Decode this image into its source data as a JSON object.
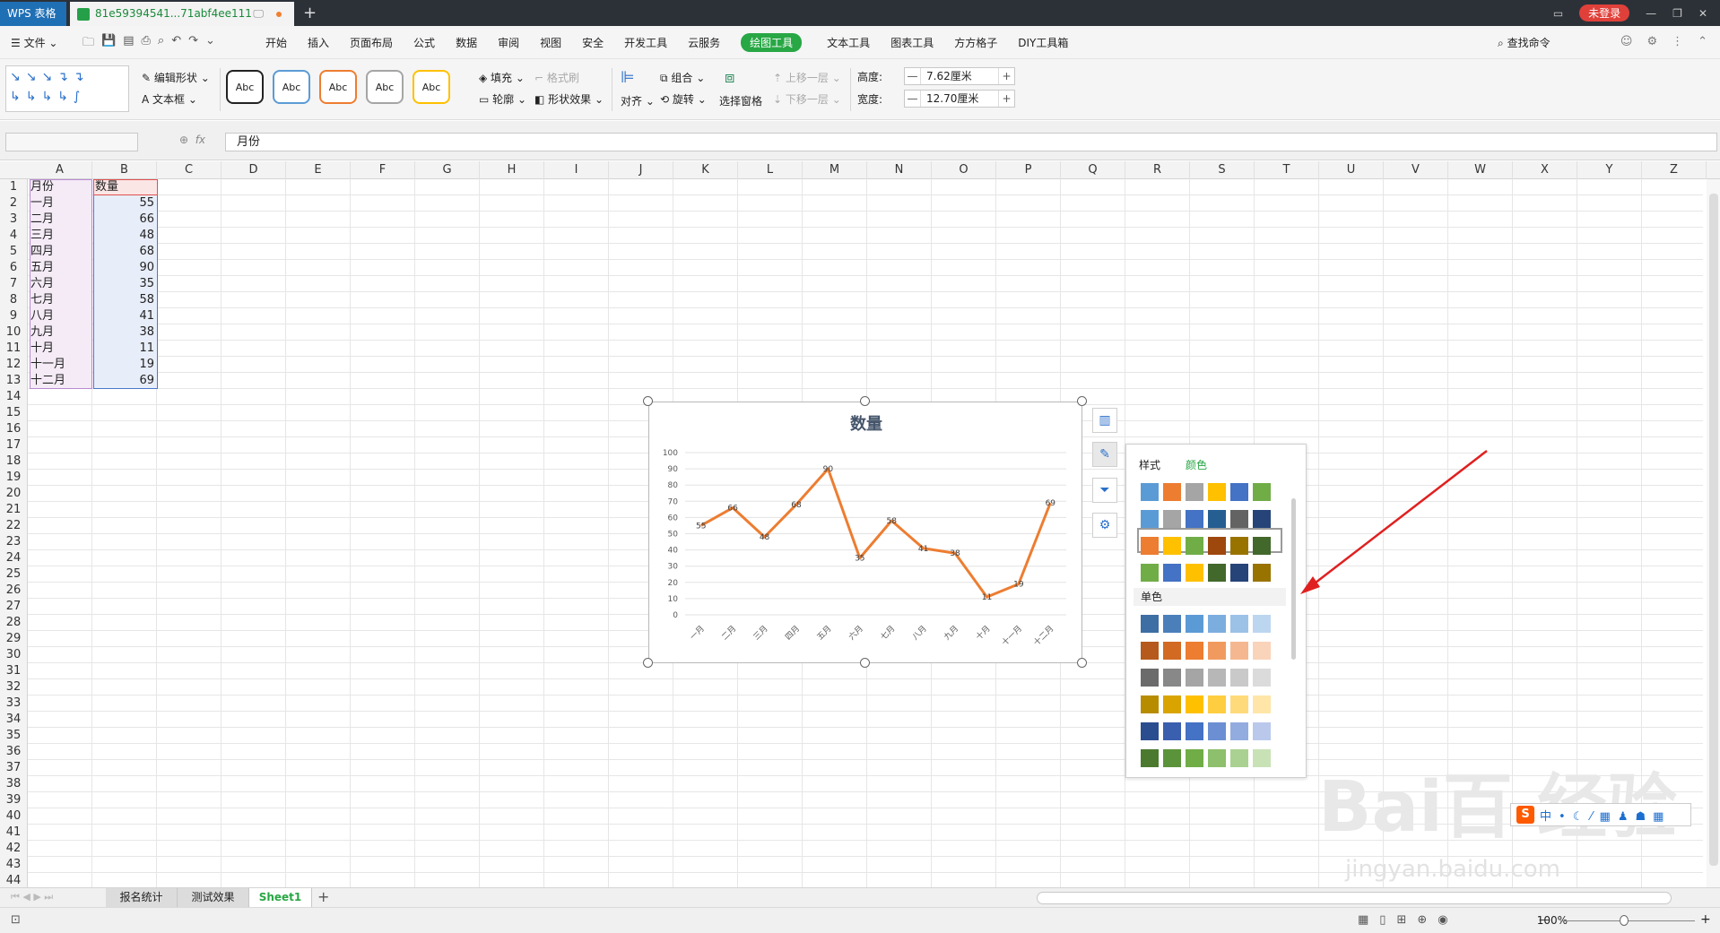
{
  "titlebar": {
    "app_tab": "WPS 表格",
    "doc_tab": "81e59394541...71abf4ee111",
    "new_tab": "+",
    "login": "未登录",
    "pin": "🖵",
    "min": "—",
    "max": "❐",
    "close": "✕"
  },
  "menubar": {
    "file": "文件",
    "items": [
      "开始",
      "插入",
      "页面布局",
      "公式",
      "数据",
      "审阅",
      "视图",
      "安全",
      "开发工具",
      "云服务",
      "绘图工具",
      "文本工具",
      "图表工具",
      "方方格子",
      "DIY工具箱"
    ],
    "active": "绘图工具",
    "search": "查找命令"
  },
  "toolbar": {
    "edit_shape": "编辑形状",
    "text_box": "文本框",
    "style_label": "Abc",
    "fill": "填充",
    "format_brush": "格式刷",
    "outline": "轮廓",
    "shape_effect": "形状效果",
    "align": "对齐",
    "group": "组合",
    "rotate": "旋转",
    "select_pane": "选择窗格",
    "bring_forward": "上移一层",
    "send_backward": "下移一层",
    "height_label": "高度:",
    "height_value": "7.62厘米",
    "width_label": "宽度:",
    "width_value": "12.70厘米",
    "minus": "—",
    "plus": "+"
  },
  "formula": {
    "fx": "fx",
    "value": "月份"
  },
  "columns": [
    "A",
    "B",
    "C",
    "D",
    "E",
    "F",
    "G",
    "H",
    "I",
    "J",
    "K",
    "L",
    "M",
    "N",
    "O",
    "P",
    "Q",
    "R",
    "S",
    "T",
    "U",
    "V",
    "W",
    "X",
    "Y",
    "Z"
  ],
  "rows": [
    "1",
    "2",
    "3",
    "4",
    "5",
    "6",
    "7",
    "8",
    "9",
    "10",
    "11",
    "12",
    "13",
    "14",
    "15",
    "16",
    "17",
    "18",
    "19",
    "20",
    "21",
    "22",
    "23",
    "24",
    "25",
    "26",
    "27",
    "28",
    "29",
    "30",
    "31",
    "32",
    "33",
    "34",
    "35",
    "36",
    "37",
    "38",
    "39",
    "40",
    "41",
    "42",
    "43",
    "44"
  ],
  "table": {
    "header": [
      "月份",
      "数量"
    ],
    "data": [
      [
        "一月",
        "55"
      ],
      [
        "二月",
        "66"
      ],
      [
        "三月",
        "48"
      ],
      [
        "四月",
        "68"
      ],
      [
        "五月",
        "90"
      ],
      [
        "六月",
        "35"
      ],
      [
        "七月",
        "58"
      ],
      [
        "八月",
        "41"
      ],
      [
        "九月",
        "38"
      ],
      [
        "十月",
        "11"
      ],
      [
        "十一月",
        "19"
      ],
      [
        "十二月",
        "69"
      ]
    ]
  },
  "chart_data": {
    "type": "line",
    "title": "数量",
    "categories": [
      "一月",
      "二月",
      "三月",
      "四月",
      "五月",
      "六月",
      "七月",
      "八月",
      "九月",
      "十月",
      "十一月",
      "十二月"
    ],
    "values": [
      55,
      66,
      48,
      68,
      90,
      35,
      58,
      41,
      38,
      11,
      19,
      69
    ],
    "ylim": [
      0,
      100
    ],
    "yticks": [
      "0",
      "10",
      "20",
      "30",
      "40",
      "50",
      "60",
      "70",
      "80",
      "90",
      "100"
    ],
    "line_color": "#ed7d31",
    "grid": true,
    "data_labels": true
  },
  "side_buttons": [
    "chart-elements-icon",
    "chart-style-icon",
    "chart-filter-icon",
    "chart-settings-icon"
  ],
  "color_panel": {
    "tab_style": "样式",
    "tab_color": "颜色",
    "mono_label": "单色",
    "multi_rows": [
      [
        "#5b9bd5",
        "#ed7d31",
        "#a5a5a5",
        "#ffc000",
        "#4472c4",
        "#70ad47"
      ],
      [
        "#5b9bd5",
        "#a5a5a5",
        "#4472c4",
        "#255e91",
        "#636363",
        "#264478"
      ],
      [
        "#ed7d31",
        "#ffc000",
        "#70ad47",
        "#9e480e",
        "#997300",
        "#43682b"
      ],
      [
        "#70ad47",
        "#4472c4",
        "#ffc000",
        "#43682b",
        "#264478",
        "#997300"
      ]
    ],
    "mono_rows": [
      [
        "#3d6ea4",
        "#4a7fba",
        "#5b9bd5",
        "#7caddf",
        "#9cc2e8",
        "#bcd6f0"
      ],
      [
        "#b55a1c",
        "#d26a24",
        "#ed7d31",
        "#f19a60",
        "#f5b78f",
        "#f9d3ba"
      ],
      [
        "#6b6b6b",
        "#888888",
        "#a5a5a5",
        "#b7b7b7",
        "#c9c9c9",
        "#dbdbdb"
      ],
      [
        "#b88c00",
        "#d9a400",
        "#ffc000",
        "#ffcd40",
        "#ffda7a",
        "#ffe6a8"
      ],
      [
        "#2a4d8f",
        "#3a5fae",
        "#4472c4",
        "#6b8fd2",
        "#93acdf",
        "#bac9eb"
      ],
      [
        "#4b7a2f",
        "#5b933a",
        "#70ad47",
        "#8dbf6c",
        "#aad191",
        "#c8e2b6"
      ]
    ]
  },
  "sheets": [
    "报名统计",
    "测试效果",
    "Sheet1"
  ],
  "active_sheet": "Sheet1",
  "status": {
    "zoom": "100%"
  },
  "watermark": {
    "logo": "Bai百 经验",
    "url": "jingyan.baidu.com"
  },
  "ime": {
    "label": "S",
    "items": [
      "中",
      "•",
      "☾",
      "⁄",
      "▦",
      "♟",
      "☗",
      "▦"
    ]
  }
}
